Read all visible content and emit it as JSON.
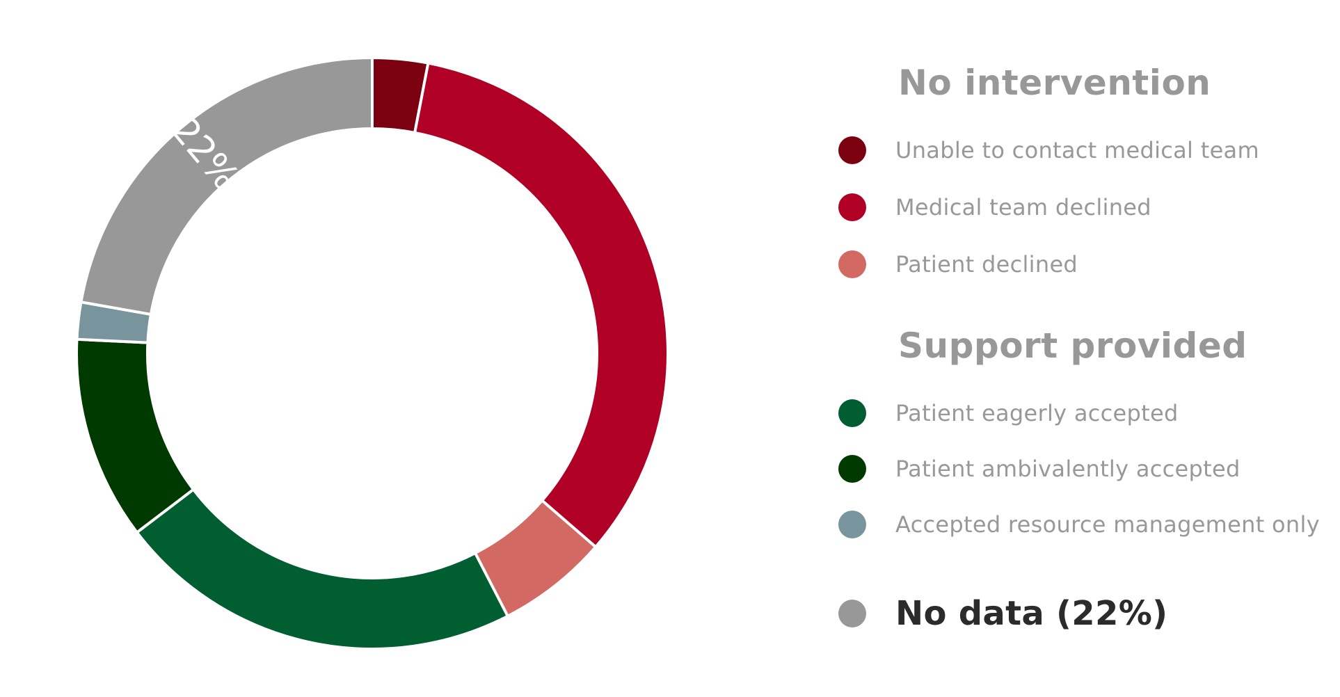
{
  "chart_data": {
    "type": "pie",
    "donut": true,
    "start_angle_deg": 0,
    "slices": [
      {
        "label": "Unable to contact medical team",
        "value": 3,
        "color": "#7b0010"
      },
      {
        "label": "Medical team declined",
        "value": 33,
        "color": "#b00026"
      },
      {
        "label": "Patient declined",
        "value": 6,
        "color": "#d26a63"
      },
      {
        "label": "Patient eagerly accepted",
        "value": 22,
        "color": "#005e30"
      },
      {
        "label": "Patient ambivalently accepted",
        "value": 11,
        "color": "#003a00"
      },
      {
        "label": "Accepted resource management only",
        "value": 2,
        "color": "#78959d"
      },
      {
        "label": "No data",
        "value": 22,
        "color": "#989898",
        "data_label": "22%"
      }
    ],
    "legend": {
      "groups": [
        {
          "title": "No intervention",
          "items": [
            {
              "label": "Unable to contact medical team",
              "color": "#7b0010"
            },
            {
              "label": "Medical team declined",
              "color": "#b00026"
            },
            {
              "label": "Patient declined",
              "color": "#d26a63"
            }
          ]
        },
        {
          "title": "Support provided",
          "items": [
            {
              "label": "Patient eagerly accepted",
              "color": "#005e30"
            },
            {
              "label": "Patient ambivalently accepted",
              "color": "#003a00"
            },
            {
              "label": "Accepted resource management only",
              "color": "#78959d"
            }
          ]
        }
      ],
      "extra_item": {
        "label": "No data (22%)",
        "color": "#989898"
      },
      "placement": "right"
    }
  }
}
